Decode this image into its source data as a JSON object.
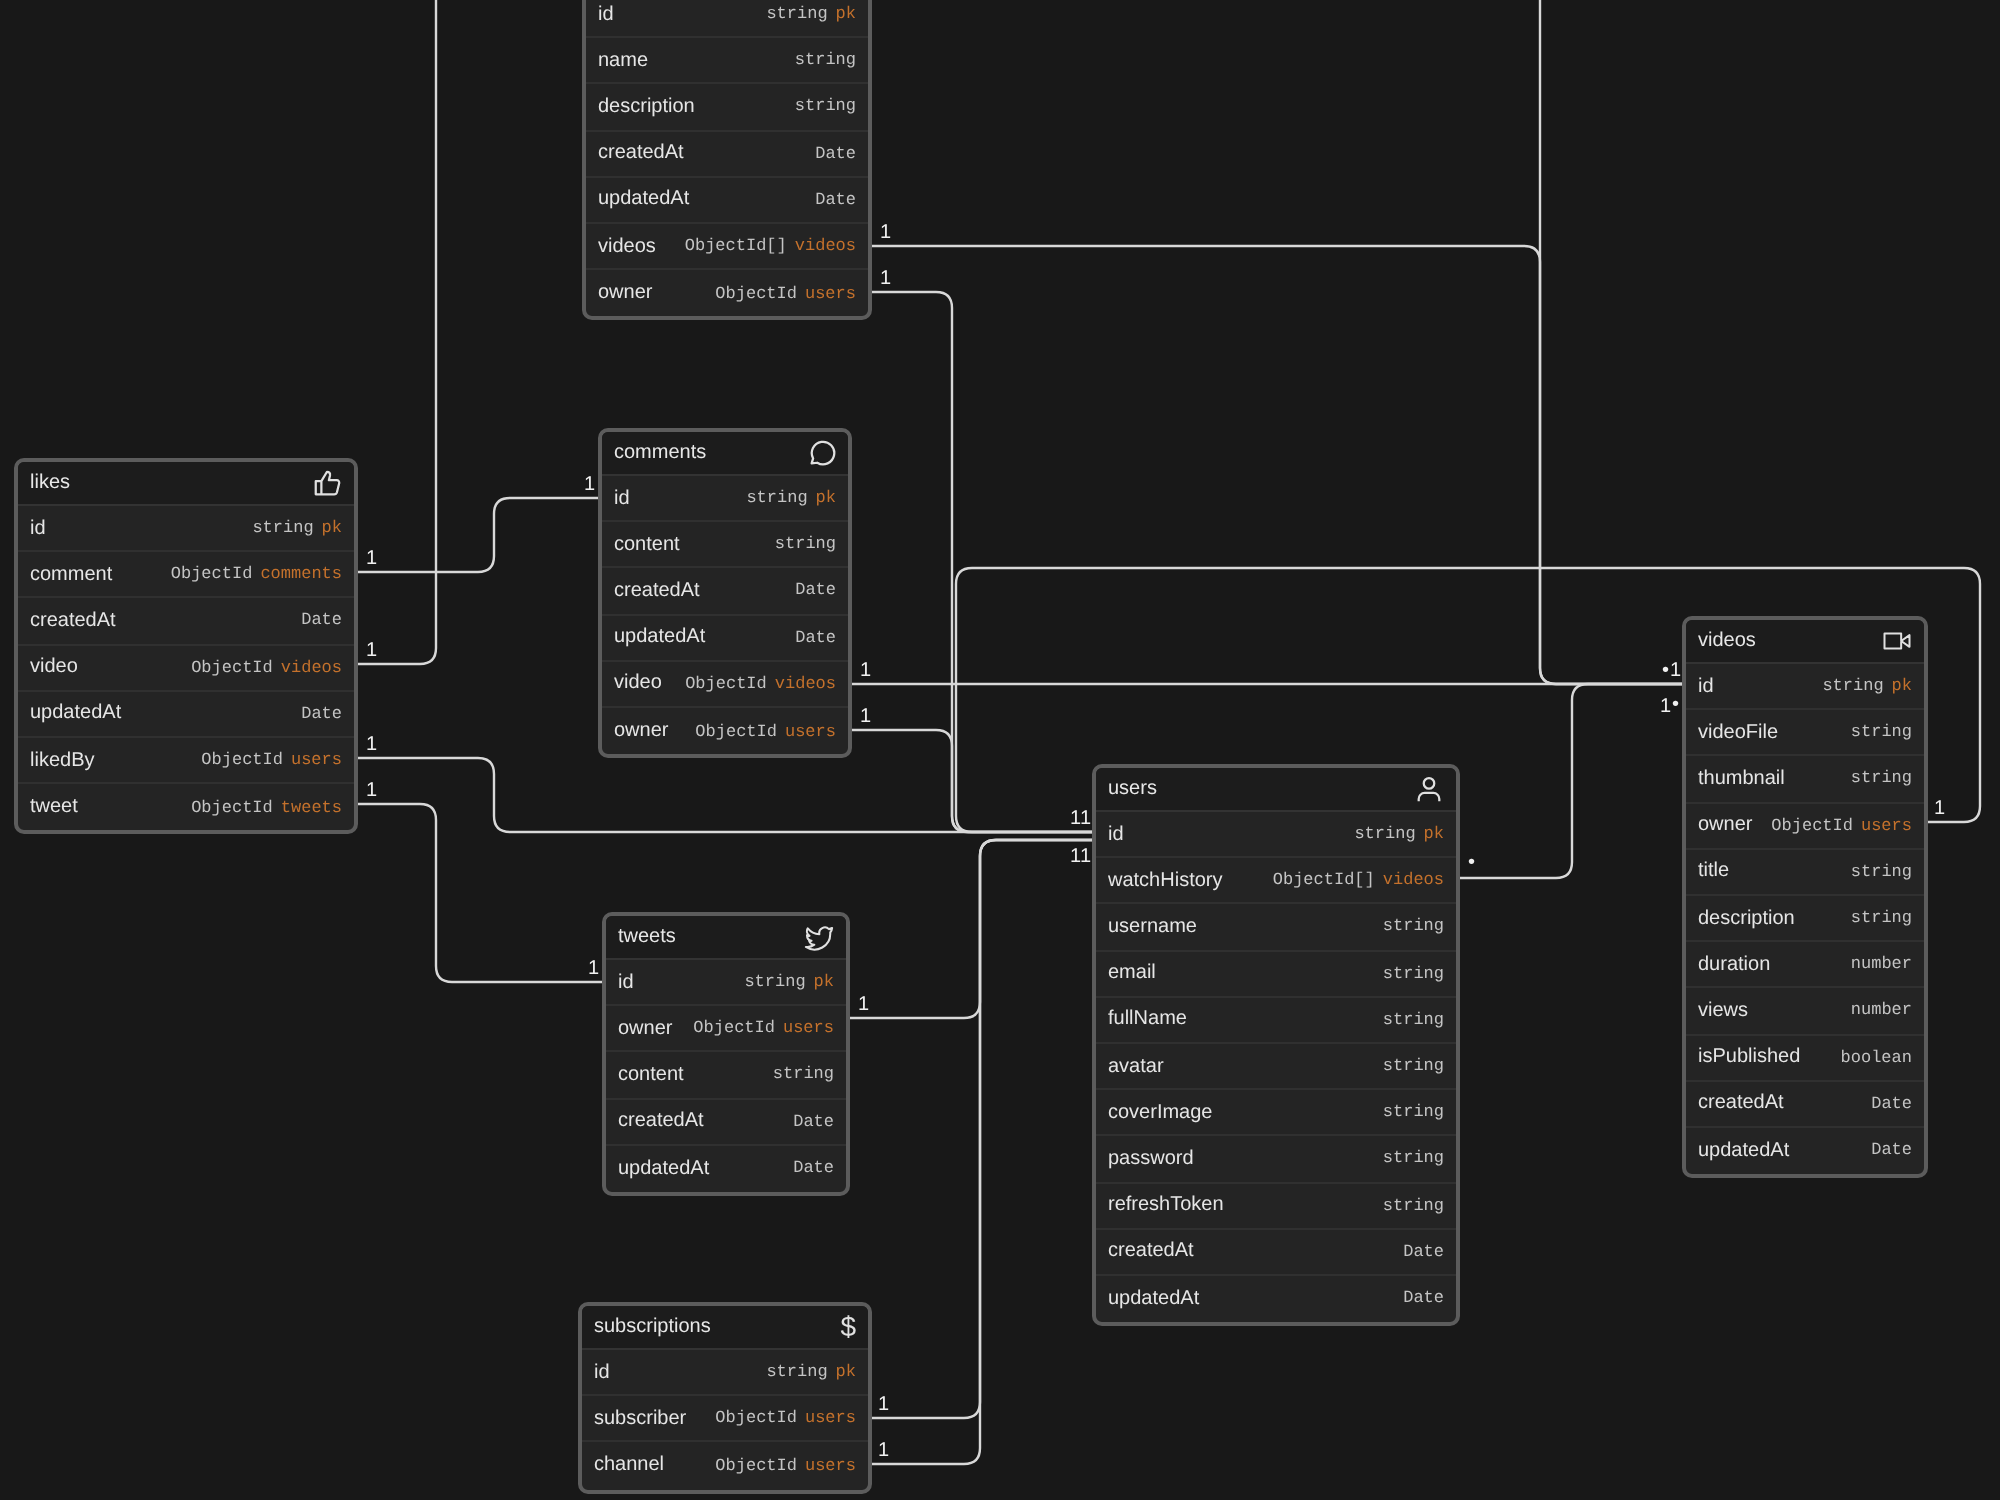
{
  "tables": [
    {
      "fields": [
        {
          "name": "id",
          "type": "string",
          "tag": "pk"
        },
        {
          "name": "name",
          "type": "string"
        },
        {
          "name": "description",
          "type": "string"
        },
        {
          "name": "createdAt",
          "type": "Date"
        },
        {
          "name": "updatedAt",
          "type": "Date"
        },
        {
          "name": "videos",
          "type": "ObjectId[]",
          "tag": "videos"
        },
        {
          "name": "owner",
          "type": "ObjectId",
          "tag": "users"
        }
      ]
    },
    {
      "title": "likes",
      "fields": [
        {
          "name": "id",
          "type": "string",
          "tag": "pk"
        },
        {
          "name": "comment",
          "type": "ObjectId",
          "tag": "comments"
        },
        {
          "name": "createdAt",
          "type": "Date"
        },
        {
          "name": "video",
          "type": "ObjectId",
          "tag": "videos"
        },
        {
          "name": "updatedAt",
          "type": "Date"
        },
        {
          "name": "likedBy",
          "type": "ObjectId",
          "tag": "users"
        },
        {
          "name": "tweet",
          "type": "ObjectId",
          "tag": "tweets"
        }
      ]
    },
    {
      "title": "comments",
      "fields": [
        {
          "name": "id",
          "type": "string",
          "tag": "pk"
        },
        {
          "name": "content",
          "type": "string"
        },
        {
          "name": "createdAt",
          "type": "Date"
        },
        {
          "name": "updatedAt",
          "type": "Date"
        },
        {
          "name": "video",
          "type": "ObjectId",
          "tag": "videos"
        },
        {
          "name": "owner",
          "type": "ObjectId",
          "tag": "users"
        }
      ]
    },
    {
      "title": "tweets",
      "fields": [
        {
          "name": "id",
          "type": "string",
          "tag": "pk"
        },
        {
          "name": "owner",
          "type": "ObjectId",
          "tag": "users"
        },
        {
          "name": "content",
          "type": "string"
        },
        {
          "name": "createdAt",
          "type": "Date"
        },
        {
          "name": "updatedAt",
          "type": "Date"
        }
      ]
    },
    {
      "title": "users",
      "fields": [
        {
          "name": "id",
          "type": "string",
          "tag": "pk"
        },
        {
          "name": "watchHistory",
          "type": "ObjectId[]",
          "tag": "videos"
        },
        {
          "name": "username",
          "type": "string"
        },
        {
          "name": "email",
          "type": "string"
        },
        {
          "name": "fullName",
          "type": "string"
        },
        {
          "name": "avatar",
          "type": "string"
        },
        {
          "name": "coverImage",
          "type": "string"
        },
        {
          "name": "password",
          "type": "string"
        },
        {
          "name": "refreshToken",
          "type": "string"
        },
        {
          "name": "createdAt",
          "type": "Date"
        },
        {
          "name": "updatedAt",
          "type": "Date"
        }
      ]
    },
    {
      "title": "videos",
      "fields": [
        {
          "name": "id",
          "type": "string",
          "tag": "pk"
        },
        {
          "name": "videoFile",
          "type": "string"
        },
        {
          "name": "thumbnail",
          "type": "string"
        },
        {
          "name": "owner",
          "type": "ObjectId",
          "tag": "users"
        },
        {
          "name": "title",
          "type": "string"
        },
        {
          "name": "description",
          "type": "string"
        },
        {
          "name": "duration",
          "type": "number"
        },
        {
          "name": "views",
          "type": "number"
        },
        {
          "name": "isPublished",
          "type": "boolean"
        },
        {
          "name": "createdAt",
          "type": "Date"
        },
        {
          "name": "updatedAt",
          "type": "Date"
        }
      ]
    },
    {
      "title": "subscriptions",
      "icon_text": "$",
      "fields": [
        {
          "name": "id",
          "type": "string",
          "tag": "pk"
        },
        {
          "name": "subscriber",
          "type": "ObjectId",
          "tag": "users"
        },
        {
          "name": "channel",
          "type": "ObjectId",
          "tag": "users"
        }
      ]
    }
  ],
  "connectors": [
    {
      "from_label": "1",
      "to_label": "•"
    },
    {
      "from_label": "1"
    },
    {
      "to_label": "•"
    },
    {
      "from_label": "1",
      "to_label": "1"
    },
    {
      "from_label": "1"
    },
    {
      "from_label": "1",
      "to_label": "1"
    },
    {
      "from_label": "1",
      "to_label": "1"
    },
    {
      "from_label": "1",
      "to_label": "1"
    },
    {
      "from_label": "1"
    },
    {
      "from_label": "1",
      "to_label": "1"
    },
    {
      "from_label": "•",
      "to_label": "1"
    },
    {
      "from_label": "1",
      "to_label": "1"
    },
    {
      "from_label": "1",
      "to_label": "1"
    },
    {
      "from_label": "1"
    }
  ]
}
